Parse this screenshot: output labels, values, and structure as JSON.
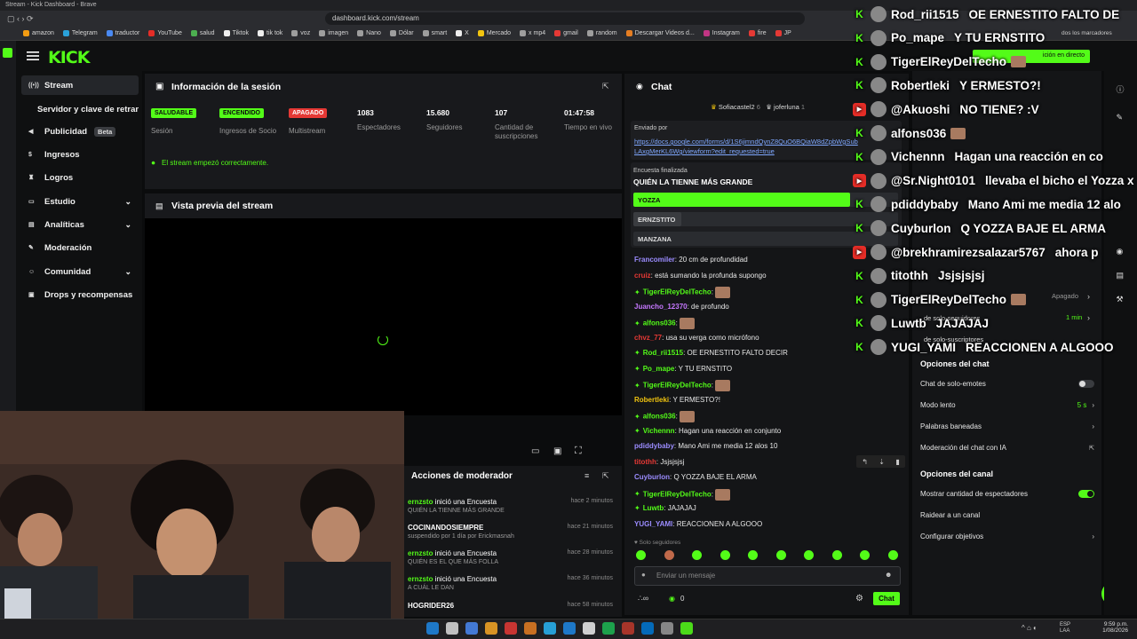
{
  "browser": {
    "tab_title": "Stream - Kick Dashboard - Brave",
    "url": "dashboard.kick.com/stream",
    "bookmarks": [
      {
        "label": "amazon",
        "color": "#f39c12"
      },
      {
        "label": "Telegram",
        "color": "#2aa1da"
      },
      {
        "label": "traductor",
        "color": "#4a8af4"
      },
      {
        "label": "YouTube",
        "color": "#e52d27"
      },
      {
        "label": "salud",
        "color": "#4caf50"
      },
      {
        "label": "Tiktok",
        "color": "#eee"
      },
      {
        "label": "tik tok",
        "color": "#eee"
      },
      {
        "label": "voz",
        "color": "#9e9e9e"
      },
      {
        "label": "imagen",
        "color": "#9e9e9e"
      },
      {
        "label": "Nano",
        "color": "#9e9e9e"
      },
      {
        "label": "Dólar",
        "color": "#9e9e9e"
      },
      {
        "label": "smart",
        "color": "#9e9e9e"
      },
      {
        "label": "X",
        "color": "#eee"
      },
      {
        "label": "Mercado",
        "color": "#f1c40f"
      },
      {
        "label": "x mp4",
        "color": "#9e9e9e"
      },
      {
        "label": "gmail",
        "color": "#e53935"
      },
      {
        "label": "random",
        "color": "#9e9e9e"
      },
      {
        "label": "Descargar Videos d...",
        "color": "#e67e22"
      },
      {
        "label": "Instagram",
        "color": "#c13584"
      },
      {
        "label": "fire",
        "color": "#e53935"
      },
      {
        "label": "JP",
        "color": "#e53935"
      }
    ],
    "all_bookmarks": "dos los marcadores"
  },
  "kick": {
    "logo": "KICK",
    "sidebar": [
      {
        "label": "Stream",
        "icon": "broadcast-icon",
        "active": true,
        "arrow": false
      },
      {
        "label": "Servidor y clave de retransm",
        "icon": "",
        "active": false,
        "arrow": false
      },
      {
        "label": "Publicidad",
        "icon": "megaphone-icon",
        "active": false,
        "badge": "Beta"
      },
      {
        "label": "Ingresos",
        "icon": "dollar-icon",
        "active": false,
        "arrow": false
      },
      {
        "label": "Logros",
        "icon": "trophy-icon",
        "active": false,
        "arrow": false
      },
      {
        "label": "Estudio",
        "icon": "studio-icon",
        "active": false,
        "arrow": true
      },
      {
        "label": "Analíticas",
        "icon": "chart-icon",
        "active": false,
        "arrow": true
      },
      {
        "label": "Moderación",
        "icon": "wrench-icon",
        "active": false,
        "arrow": false
      },
      {
        "label": "Comunidad",
        "icon": "people-icon",
        "active": false,
        "arrow": true
      },
      {
        "label": "Drops y recompensas",
        "icon": "gift-icon",
        "active": false,
        "arrow": false
      }
    ],
    "session": {
      "title": "Información de la sesión",
      "stats": [
        {
          "badge": "SALUDABLE",
          "label": "Sesión",
          "badge_color": "#53fc18",
          "badge_text": "#0b0c0d"
        },
        {
          "badge": "ENCENDIDO",
          "label": "Ingresos de Socio",
          "badge_color": "#53fc18",
          "badge_text": "#0b0c0d"
        },
        {
          "badge": "APAGADO",
          "label": "Multistream",
          "badge_color": "#e53935",
          "badge_text": "#ffffff"
        },
        {
          "value": "1083",
          "label": "Espectadores"
        },
        {
          "value": "15.680",
          "label": "Seguidores"
        },
        {
          "value": "107",
          "label": "Cantidad de suscripciones"
        },
        {
          "value": "01:47:58",
          "label": "Tiempo en vivo"
        }
      ],
      "notice": "El stream empezó correctamente."
    },
    "preview": {
      "title": "Vista previa del stream"
    },
    "mod_actions": {
      "title": "Acciones de moderador",
      "items": [
        {
          "who": "ernzsto",
          "act": "inició una Encuesta",
          "sub": "QUIÉN LA TIENNE MÁS GRANDE",
          "time": "hace 2 minutos"
        },
        {
          "who": "COCINANDOSIEMPRE",
          "act": "",
          "sub": "suspendido por 1 día por Erickmasnah",
          "time": "hace 21 minutos"
        },
        {
          "who": "ernzsto",
          "act": "inició una Encuesta",
          "sub": "QUIÉN ES EL QUE MÁS FOLLA",
          "time": "hace 28 minutos"
        },
        {
          "who": "ernzsto",
          "act": "inició una Encuesta",
          "sub": "A CUÁL LE DAN",
          "time": "hace 36 minutos"
        },
        {
          "who": "HOGRIDER26",
          "act": "",
          "sub": "",
          "time": "hace 58 minutos"
        }
      ]
    },
    "chat": {
      "title": "Chat",
      "pinned_users": [
        "Sofiacastel2",
        "joferluna"
      ],
      "pinned_user_counts": [
        "6",
        "1"
      ],
      "pinned_by_label": "Enviado por",
      "pinned_link": "https://docs.google.com/forms/d/1S6jimndQynZ8QuO6BQiaW8dZpbWgSub",
      "pinned_link2": "LAxgMerKL6Wg/viewform?edit_requested=true",
      "poll": {
        "status": "Encuesta finalizada",
        "question": "QUIÉN LA TIENNE MÁS GRANDE",
        "options": [
          {
            "label": "YOZZA",
            "share": 0.82
          },
          {
            "label": "ERNZSTITO",
            "share": 0.18
          },
          {
            "label": "MANZANA",
            "share": 0
          }
        ]
      },
      "messages": [
        {
          "user": "Francomiler",
          "color": "#9b8cff",
          "text": "20 cm de profundidad"
        },
        {
          "user": "cruiz",
          "color": "#e53935",
          "text": "está sumando la profunda supongo"
        },
        {
          "user": "TigerElReyDelTecho",
          "color": "#53fc18",
          "text": "",
          "emote": true
        },
        {
          "user": "Juancho_12370",
          "color": "#c678ff",
          "text": "de profundo"
        },
        {
          "user": "alfons036",
          "color": "#53fc18",
          "text": "",
          "emote": true
        },
        {
          "user": "chvz_77",
          "color": "#e53935",
          "text": "usa su verga como micrófono"
        },
        {
          "user": "Rod_rii1515",
          "color": "#53fc18",
          "text": "OE ERNESTITO FALTO DECIR"
        },
        {
          "user": "Po_mape",
          "color": "#53fc18",
          "text": "Y TU ERNSTITO"
        },
        {
          "user": "TigerElReyDelTecho",
          "color": "#53fc18",
          "text": "",
          "emote": true
        },
        {
          "user": "Robertleki",
          "color": "#f1c40f",
          "text": "Y ERMESTO?!"
        },
        {
          "user": "alfons036",
          "color": "#53fc18",
          "text": "",
          "emote": true
        },
        {
          "user": "Vichennn",
          "color": "#53fc18",
          "text": "Hagan una reacción en conjunto"
        },
        {
          "user": "pdiddybaby",
          "color": "#9b8cff",
          "text": "Mano Ami me media 12 alos 10"
        },
        {
          "user": "titothh",
          "color": "#e53935",
          "text": "Jsjsjsjsj"
        },
        {
          "user": "Cuyburlon",
          "color": "#9b8cff",
          "text": "Q YOZZA BAJE EL ARMA"
        },
        {
          "user": "TigerElReyDelTecho",
          "color": "#53fc18",
          "text": "",
          "emote": true
        },
        {
          "user": "Luwtb",
          "color": "#53fc18",
          "text": "JAJAJAJ"
        },
        {
          "user": "YUGI_YAMI",
          "color": "#9b8cff",
          "text": "REACCIONEN A ALGOOO"
        }
      ],
      "followers_only": "Solo seguidores",
      "input_placeholder": "Enviar un mensaje",
      "viewers_short": "0",
      "send_label": "Chat"
    },
    "settings": {
      "partial_top": [
        "Apagado",
        "1 min"
      ],
      "chat_options_title": "Opciones del chat",
      "chat_options": [
        {
          "label": "Chat de solo-emotes",
          "type": "toggle",
          "on": false
        },
        {
          "label": "Modo lento",
          "type": "value",
          "value": "5 s"
        },
        {
          "label": "Palabras baneadas",
          "type": "arrow"
        },
        {
          "label": "Moderación del chat con IA",
          "type": "link"
        }
      ],
      "channel_options_title": "Opciones del canal",
      "channel_options": [
        {
          "label": "Mostrar cantidad de espectadores",
          "type": "toggle",
          "on": true
        },
        {
          "label": "Raidear a un canal",
          "type": "none"
        },
        {
          "label": "Configurar objetivos",
          "type": "arrow"
        }
      ],
      "live_chip": "ición en directo",
      "partial_labels": [
        "de solo-seguidores",
        "de solo-suscriptores"
      ]
    }
  },
  "overlay_chat": [
    {
      "platform": "kick",
      "user": "Rod_rii1515",
      "msg": "OE ERNESTITO FALTO DE"
    },
    {
      "platform": "kick",
      "user": "Po_mape",
      "msg": "Y TU ERNSTITO"
    },
    {
      "platform": "kick",
      "user": "TigerElReyDelTecho",
      "msg": "",
      "emote": true
    },
    {
      "platform": "kick",
      "user": "Robertleki",
      "msg": "Y ERMESTO?!"
    },
    {
      "platform": "youtube",
      "user": "@Akuoshi",
      "msg": "NO TIENE? :V"
    },
    {
      "platform": "kick",
      "user": "alfons036",
      "msg": "",
      "emote": true
    },
    {
      "platform": "kick",
      "user": "Vichennn",
      "msg": "Hagan una reacción en co"
    },
    {
      "platform": "youtube",
      "user": "@Sr.Night0101",
      "msg": "llevaba el bicho el Yozza x"
    },
    {
      "platform": "kick",
      "user": "pdiddybaby",
      "msg": "Mano Ami me media 12 alo"
    },
    {
      "platform": "kick",
      "user": "Cuyburlon",
      "msg": "Q YOZZA BAJE EL ARMA"
    },
    {
      "platform": "youtube",
      "user": "@brekhramirezsalazar5767",
      "msg": "ahora p"
    },
    {
      "platform": "kick",
      "user": "titothh",
      "msg": "Jsjsjsjsj"
    },
    {
      "platform": "kick",
      "user": "TigerElReyDelTecho",
      "msg": "",
      "emote": true
    },
    {
      "platform": "kick",
      "user": "Luwtb",
      "msg": "JAJAJAJ"
    },
    {
      "platform": "kick",
      "user": "YUGI_YAMI",
      "msg": "REACCIONEN A ALGOOO"
    }
  ],
  "taskbar": {
    "lang": "ESP\nLAA",
    "time": "9:59 p.m.",
    "date": "1/08/2026"
  }
}
